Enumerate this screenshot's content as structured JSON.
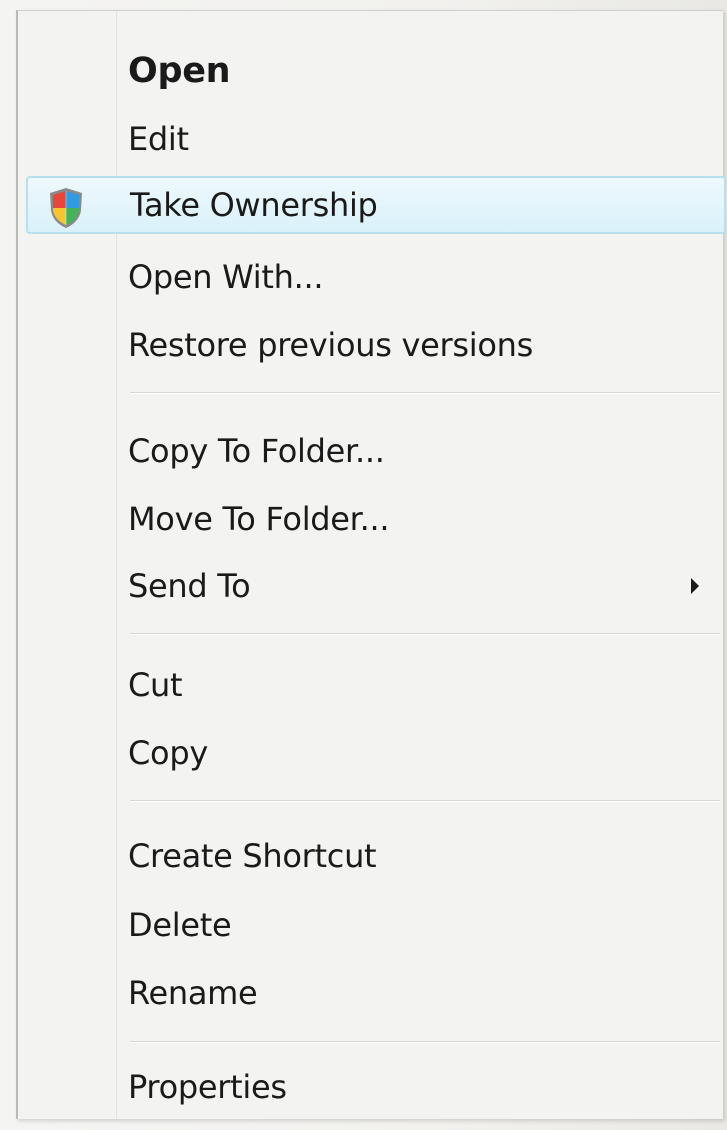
{
  "context_menu": {
    "items": [
      {
        "label": "Open",
        "default": true
      },
      {
        "label": "Edit"
      },
      {
        "label": "Take Ownership",
        "icon": "uac-shield-icon",
        "highlighted": true
      },
      {
        "label": "Open With..."
      },
      {
        "label": "Restore previous versions"
      },
      {
        "label": "Copy To Folder..."
      },
      {
        "label": "Move To Folder..."
      },
      {
        "label": "Send To",
        "submenu": true
      },
      {
        "label": "Cut"
      },
      {
        "label": "Copy"
      },
      {
        "label": "Create Shortcut"
      },
      {
        "label": "Delete"
      },
      {
        "label": "Rename"
      },
      {
        "label": "Properties"
      }
    ]
  },
  "colors": {
    "menu_background": "#f3f3f1",
    "highlight_background": "#d9f1f9",
    "highlight_border": "#b6e0ee",
    "text": "#1a1a1a"
  }
}
